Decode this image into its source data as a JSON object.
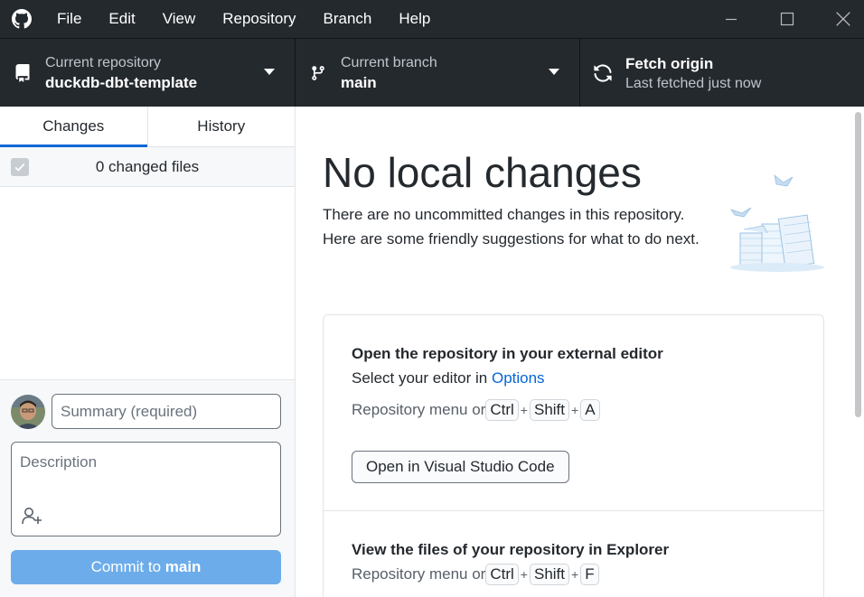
{
  "titlebar": {
    "menu": [
      "File",
      "Edit",
      "View",
      "Repository",
      "Branch",
      "Help"
    ]
  },
  "toolbar": {
    "repo": {
      "label": "Current repository",
      "value": "duckdb-dbt-template"
    },
    "branch": {
      "label": "Current branch",
      "value": "main"
    },
    "fetch": {
      "label": "Fetch origin",
      "status": "Last fetched just now"
    }
  },
  "sidebar": {
    "tabs": [
      {
        "label": "Changes",
        "active": true
      },
      {
        "label": "History",
        "active": false
      }
    ],
    "changed_files": "0 changed files",
    "commit": {
      "summary_placeholder": "Summary (required)",
      "description_placeholder": "Description",
      "button_prefix": "Commit to ",
      "button_branch": "main"
    }
  },
  "main": {
    "heading": "No local changes",
    "intro": "There are no uncommitted changes in this repository. Here are some friendly suggestions for what to do next.",
    "card": {
      "editor": {
        "title": "Open the repository in your external editor",
        "desc_prefix": "Select your editor in ",
        "desc_link": "Options",
        "shortcut_prefix": "Repository menu or ",
        "keys": [
          "Ctrl",
          "Shift",
          "A"
        ],
        "button": "Open in Visual Studio Code"
      },
      "explorer": {
        "title": "View the files of your repository in Explorer",
        "shortcut_prefix": "Repository menu or ",
        "keys": [
          "Ctrl",
          "Shift",
          "F"
        ]
      }
    }
  },
  "colors": {
    "titlebar_bg": "#24292e",
    "accent": "#0366d6",
    "commit_button": "#6cacea"
  },
  "icons": [
    "github-logo-icon",
    "minimize-icon",
    "maximize-icon",
    "close-icon",
    "repo-icon",
    "branch-icon",
    "sync-icon",
    "caret-down-icon",
    "checkbox-icon",
    "coauthor-icon"
  ]
}
